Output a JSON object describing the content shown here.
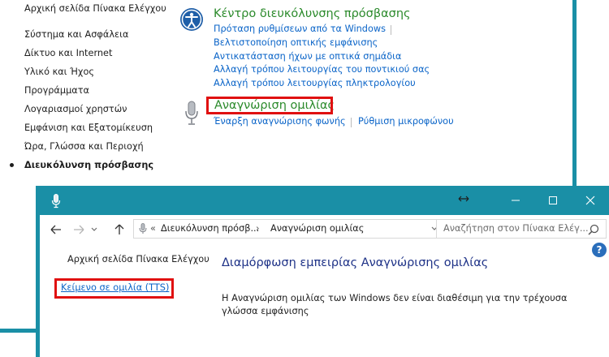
{
  "back_window": {
    "sidebar": {
      "home": "Αρχική σελίδα Πίνακα Ελέγχου",
      "items": [
        "Σύστημα και Ασφάλεια",
        "Δίκτυο και Internet",
        "Υλικό και Ήχος",
        "Προγράμματα",
        "Λογαριασμοί χρηστών",
        "Εμφάνιση και Εξατομίκευση",
        "Ώρα, Γλώσσα και Περιοχή",
        "Διευκόλυνση πρόσβασης"
      ]
    },
    "ease_center": {
      "title": "Κέντρο διευκόλυνσης πρόσβασης",
      "link_suggest": "Πρόταση ρυθμίσεων από τα Windows",
      "link_visual": "Βελτιστοποίηση οπτικής εμφάνισης",
      "link_sounds": "Αντικατάσταση ήχων με οπτικά σημάδια",
      "link_mouse": "Αλλαγή τρόπου λειτουργίας του ποντικιού σας",
      "link_keyboard": "Αλλαγή τρόπου λειτουργίας πληκτρολογίου"
    },
    "speech": {
      "title": "Αναγνώριση ομιλίας",
      "link_start": "Έναρξη αναγνώρισης φωνής",
      "link_mic": "Ρύθμιση μικροφώνου"
    }
  },
  "front_window": {
    "address": {
      "overflow": "«",
      "crumb1": "Διευκόλυνση πρόσβ...",
      "crumb2": "Αναγνώριση ομιλίας"
    },
    "search_placeholder": "Αναζήτηση στον Πίνακα Ελέγ...",
    "sidebar": {
      "home": "Αρχική σελίδα Πίνακα Ελέγχου",
      "tts": "Κείμενο σε ομιλία (TTS)"
    },
    "heading": "Διαμόρφωση εμπειρίας Αναγνώρισης ομιλίας",
    "message": "Η Αναγνώριση ομιλίας των Windows δεν είναι διαθέσιμη για την τρέχουσα γλώσσα εμφάνισης",
    "help_label": "?"
  },
  "colors": {
    "accent": "#1a8fa6",
    "link": "#0a64c8",
    "category_title": "#2b8a2b",
    "highlight": "#e01010",
    "heading": "#1e3287"
  }
}
